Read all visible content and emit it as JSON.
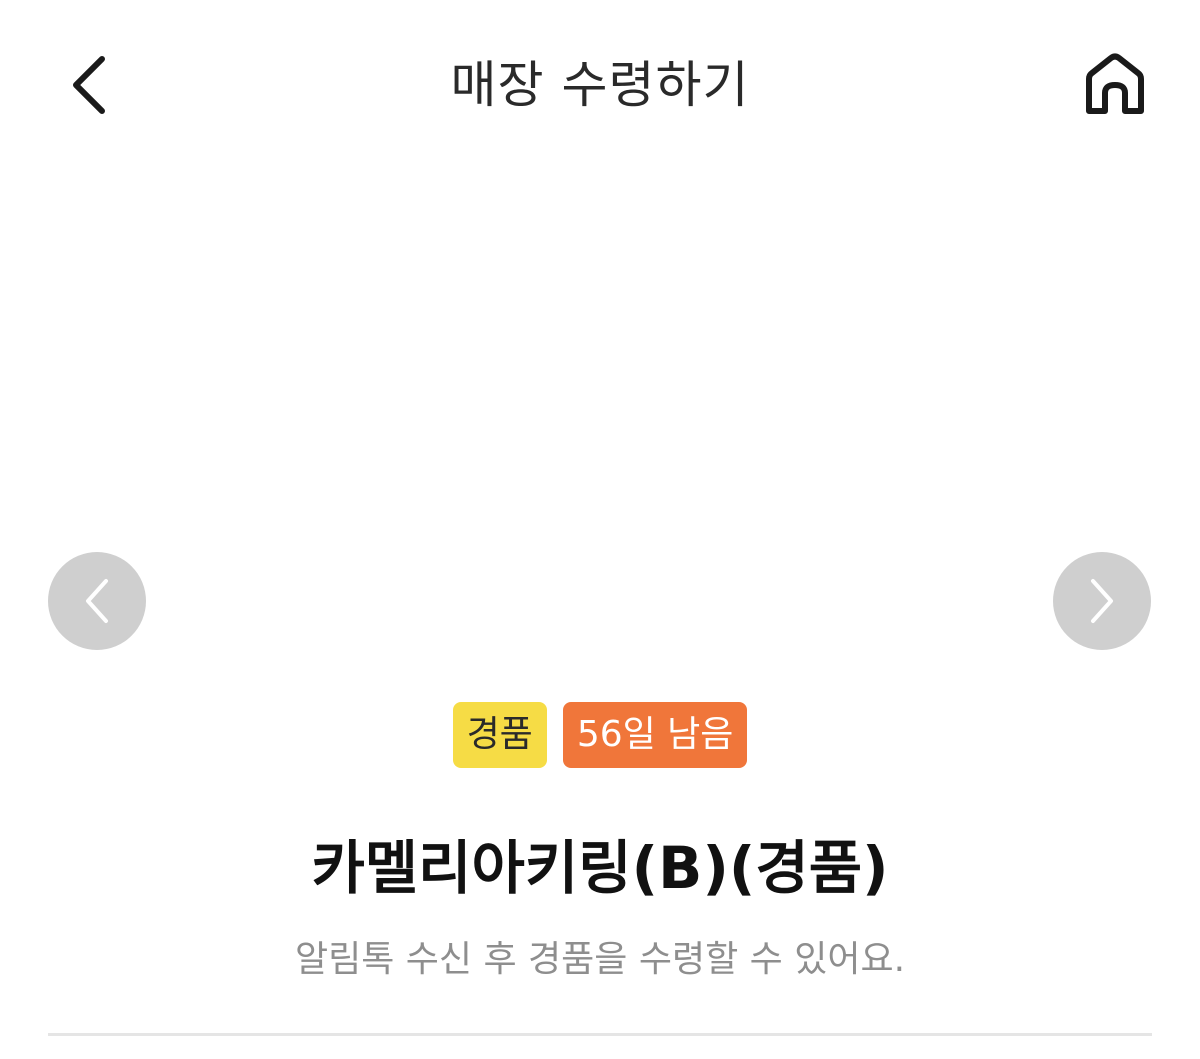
{
  "header": {
    "title": "매장 수령하기",
    "back_icon": "chevron-left-icon",
    "home_icon": "home-icon"
  },
  "carousel": {
    "prev_icon": "chevron-left-icon",
    "next_icon": "chevron-right-icon"
  },
  "badges": {
    "gift_label": "경품",
    "days_left_label": "56일 남음",
    "gift_color": "#f6dc45",
    "days_color": "#f0763a"
  },
  "product": {
    "name": "카멜리아키링(B)(경품)",
    "notice": "알림톡 수신 후 경품을 수령할 수 있어요."
  }
}
